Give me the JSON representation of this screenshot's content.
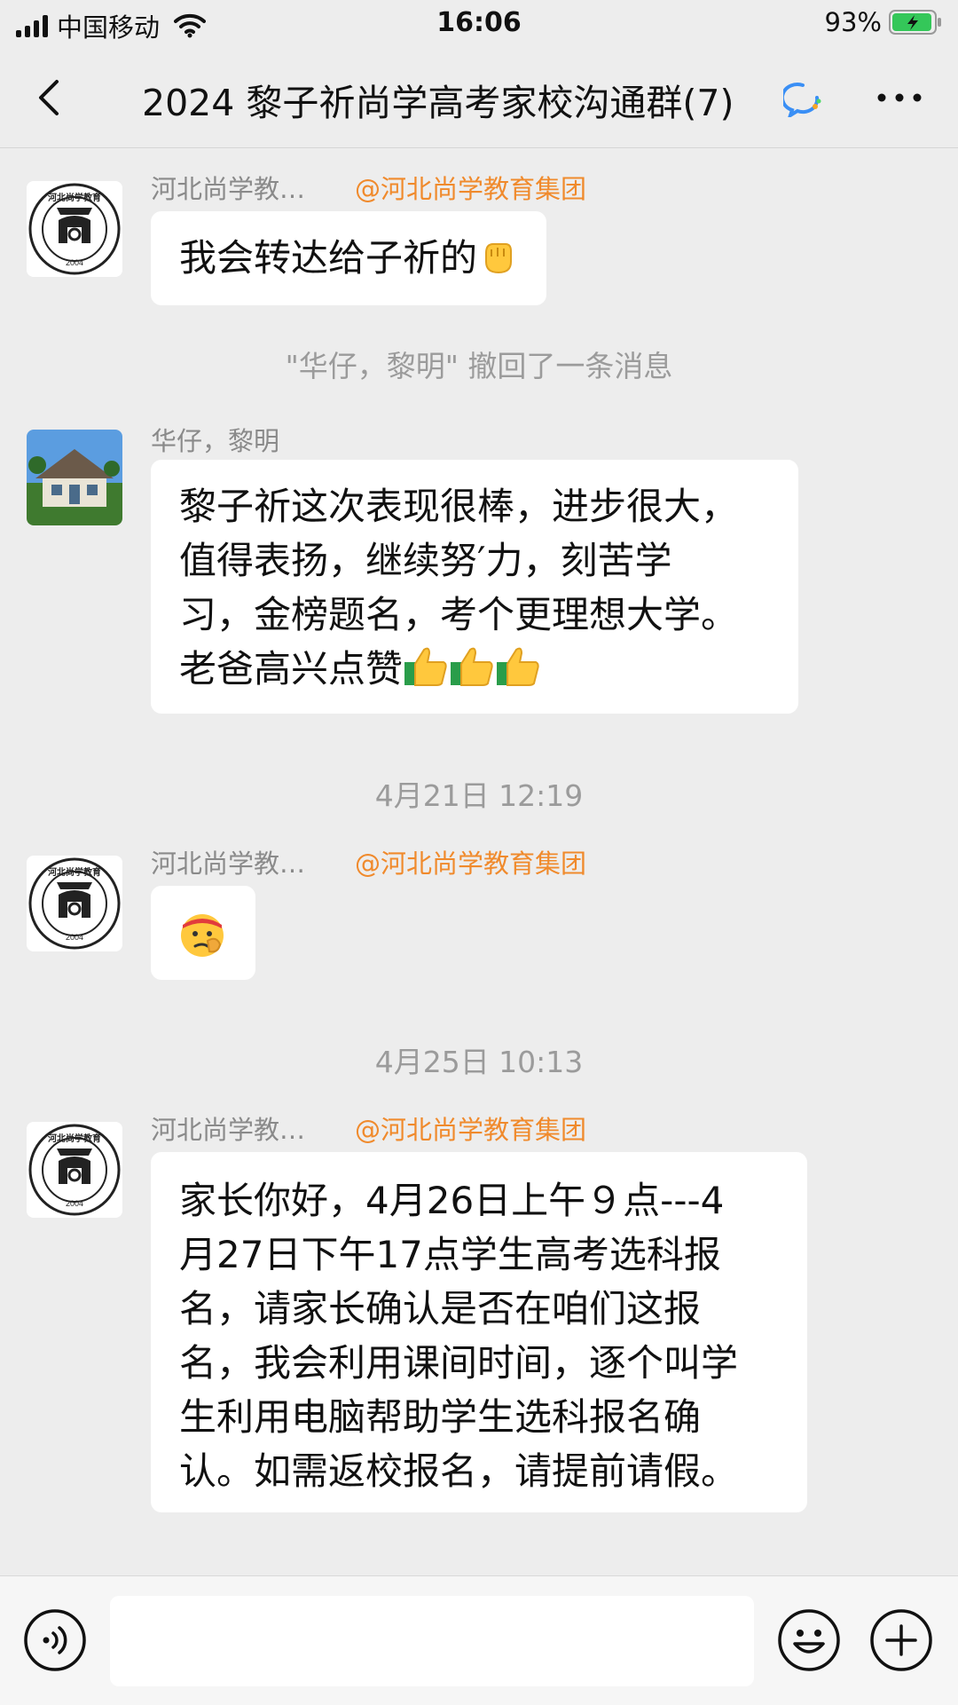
{
  "status_bar": {
    "carrier": "中国移动",
    "time": "16:06",
    "battery_percent": "93%"
  },
  "nav": {
    "title": "2024 黎子祈尚学高考家校沟通群(7)"
  },
  "messages": [
    {
      "type": "chat",
      "sender": "河北尚学教…",
      "tag": "@河北尚学教育集团",
      "text": "我会转达给子祈的",
      "emoji": "✊"
    },
    {
      "type": "system",
      "text": "\"华仔，黎明\" 撤回了一条消息"
    },
    {
      "type": "chat",
      "sender": "华仔，黎明",
      "text_lines": [
        "黎子祈这次表现很棒，进步很大，",
        "值得表扬，继续努′力，刻苦学",
        "习，金榜题名，考个更理想大学。",
        "老爸高兴点赞"
      ]
    },
    {
      "type": "time",
      "text": "4月21日 12:19"
    },
    {
      "type": "chat",
      "sender": "河北尚学教…",
      "tag": "@河北尚学教育集团",
      "emoji": "🫡"
    },
    {
      "type": "time",
      "text": "4月25日 10:13"
    },
    {
      "type": "chat",
      "sender": "河北尚学教…",
      "tag": "@河北尚学教育集团",
      "text_lines": [
        "家长你好，4月26日上午９点---4",
        "月27日下午17点学生高考选科报",
        "名，请家长确认是否在咱们这报",
        "名，我会利用课间时间，逐个叫学",
        "生利用电脑帮助学生选科报名确",
        "认。如需返校报名，请提前请假。"
      ]
    }
  ],
  "logo_text": {
    "top": "河北尚学教育",
    "year": "2004",
    "left": "SHANG XUE",
    "right": "EDUCATION"
  },
  "colors": {
    "background": "#ededed",
    "bubble": "#ffffff",
    "mention": "#f08a2c",
    "battery": "#34c759"
  },
  "icons": {
    "back": "chevron-left-icon",
    "more": "more-dots-icon",
    "voice": "voice-icon",
    "emoji": "smiley-icon",
    "plus": "plus-icon"
  }
}
